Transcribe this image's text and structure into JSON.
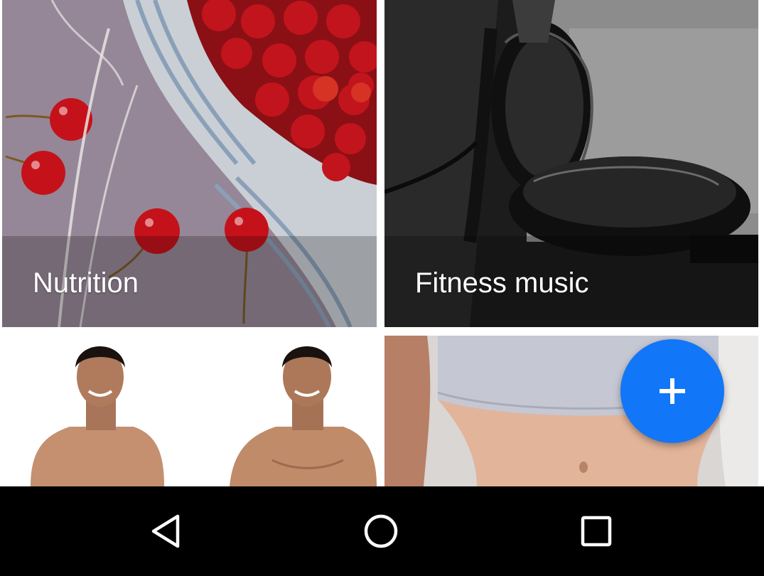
{
  "tiles": [
    {
      "id": "nutrition",
      "label": "Nutrition"
    },
    {
      "id": "fitness_music",
      "label": "Fitness music"
    },
    {
      "id": "body",
      "label": ""
    },
    {
      "id": "abs",
      "label": ""
    }
  ],
  "fab": {
    "icon": "plus-icon",
    "color": "#1176f7"
  },
  "navbar": {
    "back_icon": "back-triangle-icon",
    "home_icon": "home-circle-icon",
    "recents_icon": "recents-square-icon",
    "background": "#000000"
  }
}
